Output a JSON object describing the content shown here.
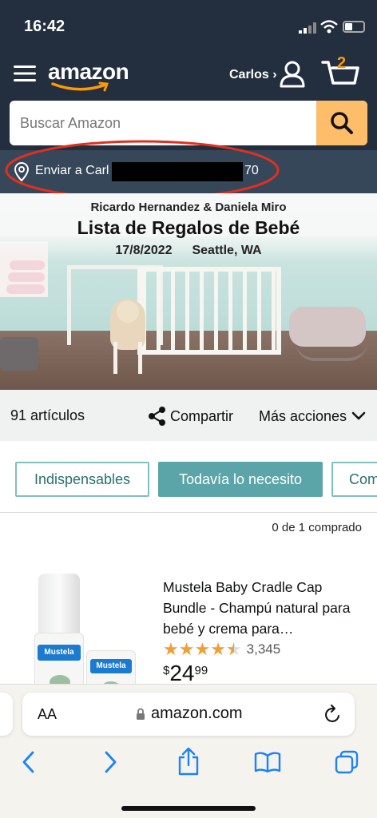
{
  "status": {
    "time": "16:42"
  },
  "header": {
    "logo": "amazon",
    "account": "Carlos ›",
    "cart_count": "2"
  },
  "search": {
    "placeholder": "Buscar Amazon"
  },
  "deliver": {
    "prefix": "Enviar a Carl",
    "suffix": "70"
  },
  "banner": {
    "names": "Ricardo Hernandez & Daniela Miro",
    "title": "Lista de Regalos de Bebé",
    "date": "17/8/2022",
    "location": "Seattle, WA"
  },
  "toolbar": {
    "count": "91 artículos",
    "share": "Compartir",
    "more": "Más acciones"
  },
  "filters": {
    "tabs": [
      "Indispensables",
      "Todavía lo necesito",
      "Com"
    ],
    "active": 1
  },
  "purchased": "0 de 1 comprado",
  "product": {
    "title": "Mustela Baby Cradle Cap Bundle - Champú natural para bebé y crema para…",
    "rating": 4.5,
    "reviews": "3,345",
    "currency": "$",
    "price_whole": "24",
    "price_fraction": "99",
    "brand_label": "Mustela"
  },
  "browser": {
    "aa": "AA",
    "url": "amazon.com"
  },
  "colors": {
    "header": "#232f3e",
    "deliver": "#37475a",
    "search_button": "#febd69",
    "accent_teal": "#5ba5a8",
    "oval": "#e0301e"
  }
}
